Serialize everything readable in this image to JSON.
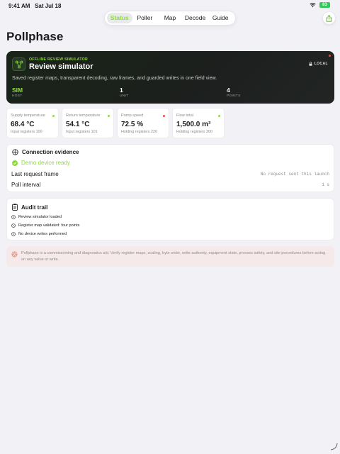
{
  "status_bar": {
    "time": "9:41 AM",
    "date": "Sat Jul 18",
    "battery": "83"
  },
  "tabs": [
    {
      "label": "Status",
      "active": true
    },
    {
      "label": "Poller",
      "active": false
    },
    {
      "label": "Map",
      "active": false
    },
    {
      "label": "Decode",
      "active": false
    },
    {
      "label": "Guide",
      "active": false
    }
  ],
  "page": {
    "title": "Pollphase"
  },
  "hero": {
    "eyebrow": "OFFLINE REVIEW SIMULATOR",
    "title": "Review simulator",
    "badge": "LOCAL",
    "description": "Saved register maps, transparent decoding, raw frames, and guarded writes in one field view.",
    "stats": [
      {
        "value": "SIM",
        "label": "HOST",
        "accent": true
      },
      {
        "value": "1",
        "label": "UNIT",
        "accent": false
      },
      {
        "value": "4",
        "label": "POINTS",
        "accent": false
      }
    ]
  },
  "metrics": [
    {
      "label": "Supply temperature",
      "value": "68.4 °C",
      "sub": "Input registers 100",
      "status_color": "#8bdc3a"
    },
    {
      "label": "Return temperature",
      "value": "54.1 °C",
      "sub": "Input registers 101",
      "status_color": "#8bdc3a"
    },
    {
      "label": "Pump speed",
      "value": "72.5 %",
      "sub": "Holding registers 220",
      "status_color": "#e5533d"
    },
    {
      "label": "Flow total",
      "value": "1,500.0 m³",
      "sub": "Holding registers 300",
      "status_color": "#8bdc3a"
    }
  ],
  "connection": {
    "title": "Connection evidence",
    "status": "Demo device ready",
    "rows": [
      {
        "label": "Last request frame",
        "value": "No request sent this launch"
      },
      {
        "label": "Poll interval",
        "value": "1 s"
      }
    ]
  },
  "audit": {
    "title": "Audit trail",
    "items": [
      "Review simulator loaded",
      "Register map validated: four points",
      "No device writes performed"
    ]
  },
  "notice": {
    "text": "Pollphase is a commissioning and diagnostics aid. Verify register maps, scaling, byte order, write authority, equipment state, process safety, and site procedures before acting on any value or write."
  },
  "colors": {
    "accent": "#8bdc3a",
    "alert": "#e5533d",
    "hero_bg": "#1c1f1d"
  }
}
